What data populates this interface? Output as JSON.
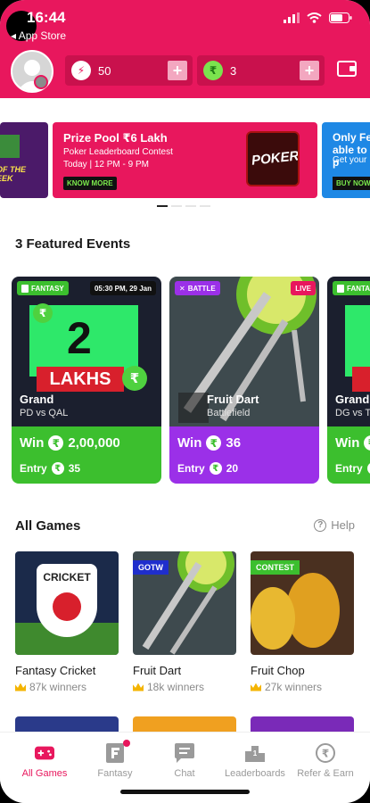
{
  "status": {
    "time": "16:44",
    "back_label": "App Store"
  },
  "header": {
    "tokens": {
      "value": "50",
      "icon": "lightning-icon"
    },
    "cash": {
      "value": "3",
      "icon": "rupee-icon"
    },
    "wallet_icon": "wallet-icon"
  },
  "banners": [
    {
      "edge_text": "OF THE\nEEK"
    },
    {
      "title": "Prize Pool ₹6 Lakh",
      "subtitle": "Poker Leaderboard Contest",
      "time": "Today | 12 PM - 9 PM",
      "cta": "KNOW MORE",
      "tile_text": "POKER"
    },
    {
      "title": "Only Fel\nable to p",
      "subtitle": "Get your",
      "cta": "BUY NOW"
    }
  ],
  "featured": {
    "title": "3 Featured Events",
    "events": [
      {
        "tag": "FANTASY",
        "time": "05:30 PM, 29 Jan",
        "name": "Grand",
        "sub": "PD vs QAL",
        "art_number": "2",
        "art_word": "LAKHS",
        "win_label": "Win",
        "win": "2,00,000",
        "entry_label": "Entry",
        "entry": "35"
      },
      {
        "tag": "BATTLE",
        "live": "LIVE",
        "name": "Fruit Dart",
        "sub": "Battlefield",
        "win_label": "Win",
        "win": "36",
        "entry_label": "Entry",
        "entry": "20"
      },
      {
        "tag": "FANTA",
        "name": "Grand",
        "sub": "DG vs TA",
        "win_label": "Win",
        "entry_label": "Entry"
      }
    ]
  },
  "all_games": {
    "title": "All Games",
    "help": "Help",
    "games": [
      {
        "name": "Fantasy Cricket",
        "winners": "87k winners",
        "art_text": "CRICKET"
      },
      {
        "name": "Fruit Dart",
        "winners": "18k winners",
        "badge": "GOTW"
      },
      {
        "name": "Fruit Chop",
        "winners": "27k winners",
        "badge": "CONTEST"
      }
    ]
  },
  "nav": [
    {
      "label": "All Games",
      "icon": "gamepad-icon",
      "active": true
    },
    {
      "label": "Fantasy",
      "icon": "fantasy-icon"
    },
    {
      "label": "Chat",
      "icon": "chat-icon"
    },
    {
      "label": "Leaderboards",
      "icon": "leaderboard-icon"
    },
    {
      "label": "Refer & Earn",
      "icon": "rupee-icon"
    }
  ],
  "colors": {
    "brand": "#e8175d",
    "fantasy_green": "#3cbf2e",
    "battle_purple": "#9b30e8"
  }
}
